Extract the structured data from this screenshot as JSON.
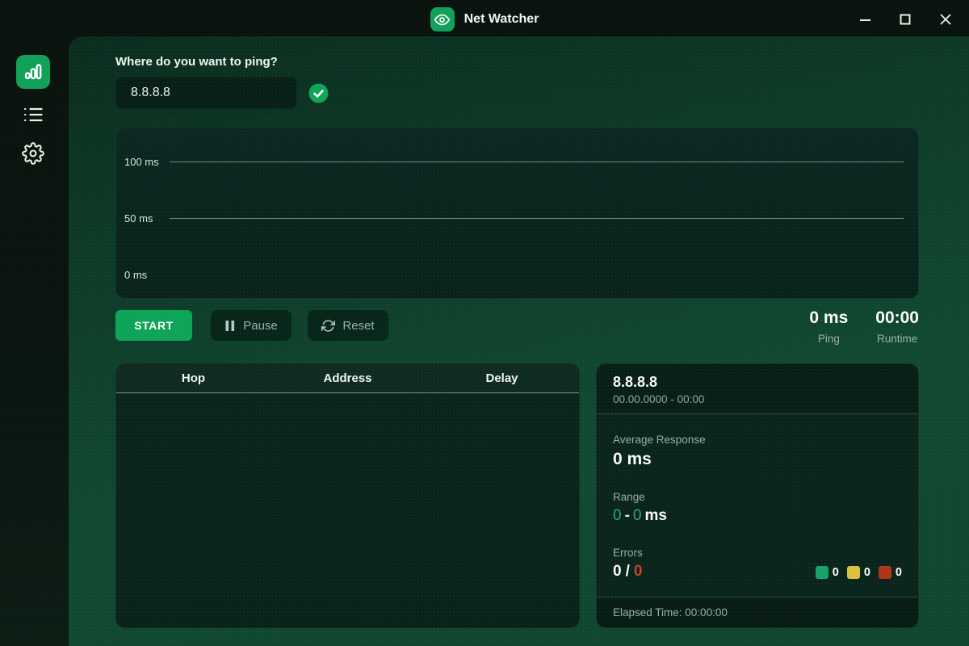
{
  "titlebar": {
    "app_name": "Net Watcher"
  },
  "sidebar": {
    "items": [
      {
        "icon": "bar-chart-icon",
        "active": true
      },
      {
        "icon": "list-icon",
        "active": false
      },
      {
        "icon": "gear-icon",
        "active": false
      }
    ]
  },
  "main": {
    "ask_label": "Where do you want to ping?",
    "ping": {
      "value": "8.8.8.8",
      "placeholder": ""
    },
    "chart": {
      "type": "line",
      "title": "",
      "y_ticks": [
        "100 ms",
        "50 ms",
        "0 ms"
      ],
      "ylim": [
        0,
        100
      ],
      "grid": true,
      "series": []
    },
    "controls": {
      "start": "START",
      "pause": "Pause",
      "reset": "Reset"
    },
    "stats": {
      "ping_value": "0 ms",
      "ping_label": "Ping",
      "runtime_value": "00:00",
      "runtime_label": "Runtime"
    },
    "table": {
      "headers": [
        "Hop",
        "Address",
        "Delay"
      ],
      "rows": []
    },
    "details": {
      "target": "8.8.8.8",
      "subtitle": "00.00.0000 - 00:00",
      "avg_label": "Average Response",
      "avg_value": "0 ms",
      "range_label": "Range",
      "range_min": "0",
      "range_sep": "-",
      "range_max": "0",
      "range_unit": "ms",
      "errors_label": "Errors",
      "errors_current": "0",
      "errors_sep": "/",
      "errors_total": "0",
      "legend": [
        {
          "name": "success",
          "color": "#17a268",
          "value": "0"
        },
        {
          "name": "warning",
          "color": "#ddc23b",
          "value": "0"
        },
        {
          "name": "error",
          "color": "#b03418",
          "value": "0"
        }
      ],
      "elapsed": "Elapsed Time: 00:00:00"
    }
  },
  "colors": {
    "accent_green": "#12a159",
    "background_dark": "#0a120e",
    "content_green": "#114831",
    "panel_dark": "#0a231b",
    "range_green": "#2fa874",
    "error_red": "#c84324"
  }
}
